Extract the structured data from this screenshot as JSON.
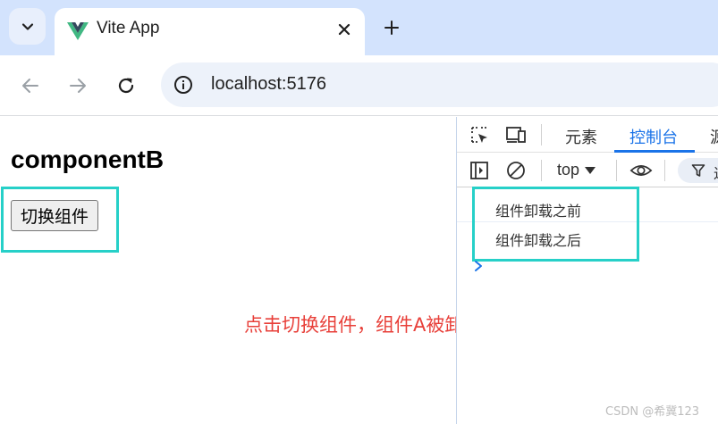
{
  "browser": {
    "tab": {
      "title": "Vite App"
    },
    "omnibox": {
      "url": "localhost:5176"
    }
  },
  "page": {
    "heading": "componentB",
    "switch_button_label": "切换组件",
    "annotation": "点击切换组件，组件A被卸载"
  },
  "devtools": {
    "tabs": [
      "元素",
      "控制台",
      "源"
    ],
    "active_tab": "控制台",
    "context": "top",
    "filter_placeholder": "过",
    "console_logs": [
      "组件卸载之前",
      "组件卸载之后"
    ]
  },
  "watermark": "CSDN @希冀123",
  "colors": {
    "highlight": "#26d0c8",
    "annotation": "#e8403a",
    "devtools_accent": "#1a73e8",
    "tabstrip": "#d3e3fd"
  }
}
